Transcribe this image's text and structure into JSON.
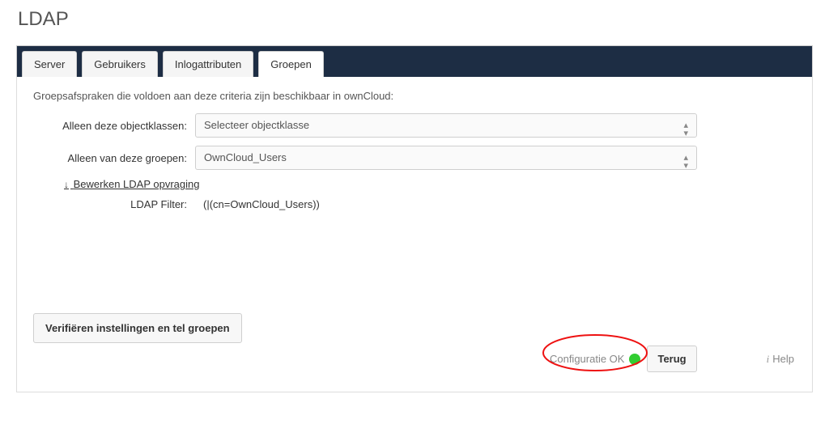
{
  "title": "LDAP",
  "tabs": [
    {
      "label": "Server"
    },
    {
      "label": "Gebruikers"
    },
    {
      "label": "Inlogattributen"
    },
    {
      "label": "Groepen"
    }
  ],
  "intro": "Groepsafspraken die voldoen aan deze criteria zijn beschikbaar in ownCloud:",
  "fields": {
    "object_classes": {
      "label": "Alleen deze objectklassen:",
      "value": "Selecteer objectklasse"
    },
    "groups": {
      "label": "Alleen van deze groepen:",
      "value": "OwnCloud_Users"
    }
  },
  "edit_link": "Bewerken LDAP opvraging",
  "filter": {
    "label": "LDAP Filter:",
    "value": "(|(cn=OwnCloud_Users))"
  },
  "verify_button": "Verifiëren instellingen en tel groepen",
  "status": "Configuratie OK",
  "back_button": "Terug",
  "help": "Help"
}
